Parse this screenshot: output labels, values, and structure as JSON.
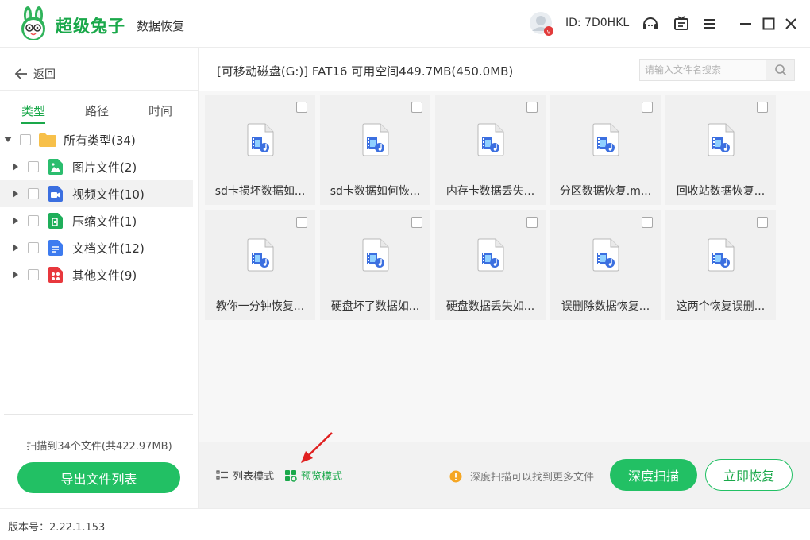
{
  "app": {
    "brand": "超级兔子",
    "brand_sub": "数据恢复",
    "user_id": "ID: 7D0HKL",
    "accent": "#22c064"
  },
  "titlebar": {
    "icons": [
      "headset-icon",
      "share-icon",
      "menu-icon",
      "minimize-icon",
      "maximize-icon",
      "close-icon"
    ]
  },
  "sidebar": {
    "back_label": "返回",
    "tabs": [
      {
        "label": "类型",
        "active": true
      },
      {
        "label": "路径",
        "active": false
      },
      {
        "label": "时间",
        "active": false
      }
    ],
    "tree": [
      {
        "label": "所有类型(34)",
        "icon": "folder-icon",
        "expanded": true
      },
      {
        "label": "图片文件(2)",
        "icon": "image-file-icon"
      },
      {
        "label": "视频文件(10)",
        "icon": "video-file-icon",
        "selected": true
      },
      {
        "label": "压缩文件(1)",
        "icon": "zip-file-icon"
      },
      {
        "label": "文档文件(12)",
        "icon": "document-file-icon"
      },
      {
        "label": "其他文件(9)",
        "icon": "other-file-icon"
      }
    ],
    "scan_summary": "扫描到34个文件(共422.97MB)",
    "export_label": "导出文件列表"
  },
  "main": {
    "disk_info": "[可移动磁盘(G:)] FAT16 可用空间449.7MB(450.0MB)",
    "search_placeholder": "请输入文件名搜索",
    "files": [
      "sd卡损坏数据如...",
      "sd卡数据如何恢...",
      "内存卡数据丢失...",
      "分区数据恢复.m...",
      "回收站数据恢复...",
      "教你一分钟恢复...",
      "硬盘坏了数据如...",
      "硬盘数据丢失如...",
      "误删除数据恢复...",
      "这两个恢复误删..."
    ]
  },
  "bottom": {
    "list_mode": "列表模式",
    "preview_mode": "预览模式",
    "hint": "深度扫描可以找到更多文件",
    "deep_scan": "深度扫描",
    "recover_now": "立即恢复"
  },
  "status": {
    "version": "版本号：2.22.1.153"
  }
}
